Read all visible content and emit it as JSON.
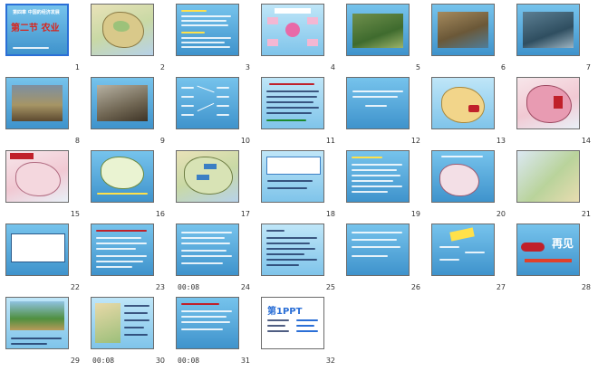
{
  "slides": [
    {
      "number": "1",
      "title": "第二节 农业",
      "subtitle": "第四章 中国的经济发展"
    },
    {
      "number": "2"
    },
    {
      "number": "3"
    },
    {
      "number": "4"
    },
    {
      "number": "5"
    },
    {
      "number": "6"
    },
    {
      "number": "7"
    },
    {
      "number": "8"
    },
    {
      "number": "9"
    },
    {
      "number": "10"
    },
    {
      "number": "11"
    },
    {
      "number": "12"
    },
    {
      "number": "13"
    },
    {
      "number": "14"
    },
    {
      "number": "15"
    },
    {
      "number": "16"
    },
    {
      "number": "17"
    },
    {
      "number": "18"
    },
    {
      "number": "19"
    },
    {
      "number": "20"
    },
    {
      "number": "21"
    },
    {
      "number": "22"
    },
    {
      "number": "23"
    },
    {
      "number": "24",
      "timing": "00:08"
    },
    {
      "number": "25"
    },
    {
      "number": "26"
    },
    {
      "number": "27"
    },
    {
      "number": "28",
      "title": "再见"
    },
    {
      "number": "29"
    },
    {
      "number": "30",
      "timing": "00:08"
    },
    {
      "number": "31",
      "timing": "00:08"
    },
    {
      "number": "32",
      "title": "第1PPT"
    }
  ],
  "selected_slide": "1",
  "colors": {
    "selection": "#2b6fd6",
    "slide_blue": "#4fa0d4",
    "accent_red": "#c0202a"
  }
}
